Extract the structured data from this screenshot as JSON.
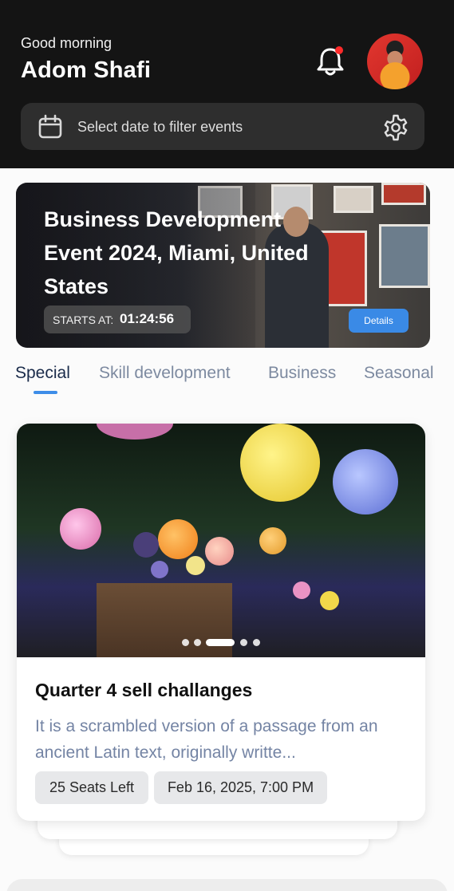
{
  "header": {
    "greeting": "Good morning",
    "user_name": "Adom Shafi",
    "notification_icon": "bell-icon",
    "avatar_icon": "user-avatar",
    "date_filter": {
      "placeholder": "Select date to filter events",
      "icon": "calendar-icon",
      "settings_icon": "gear-icon"
    }
  },
  "featured": {
    "title": "Business Development Event 2024, Miami, United States",
    "starts_label": "STARTS AT:",
    "countdown": "01:24:56",
    "details_label": "Details"
  },
  "tabs": [
    {
      "label": "Special",
      "active": true
    },
    {
      "label": "Skill development",
      "active": false
    },
    {
      "label": "Business",
      "active": false
    },
    {
      "label": "Seasonal",
      "active": false
    }
  ],
  "event_card": {
    "title": "Quarter 4 sell challanges",
    "description": "It is a scrambled version of a passage from an ancient Latin text, originally writte...",
    "seats": "25 Seats Left",
    "date": "Feb 16, 2025, 7:00 PM",
    "carousel": {
      "count": 5,
      "active_index": 2
    }
  },
  "colors": {
    "accent": "#3a8ae6",
    "header_bg": "#141414",
    "notification_dot": "#ff2a2a"
  }
}
